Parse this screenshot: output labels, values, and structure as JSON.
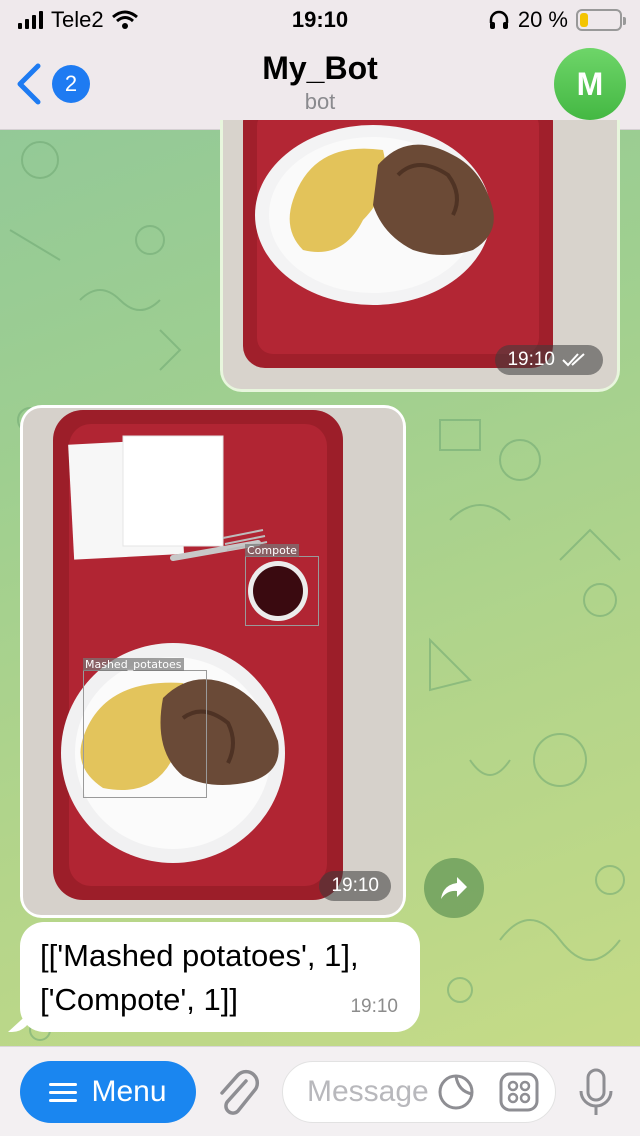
{
  "status_bar": {
    "carrier": "Tele2",
    "time": "19:10",
    "battery_percent": "20 %",
    "battery_level": 0.2
  },
  "header": {
    "back_badge": "2",
    "title": "My_Bot",
    "subtitle": "bot",
    "avatar_letter": "M"
  },
  "messages": {
    "outgoing_photo": {
      "time": "19:10"
    },
    "incoming_photo": {
      "time": "19:10",
      "detections": [
        {
          "label": "Compote"
        },
        {
          "label": "Mashed_potatoes"
        }
      ]
    },
    "incoming_text": {
      "text": "[['Mashed potatoes', 1],\n['Compote', 1]]",
      "time": "19:10"
    }
  },
  "input_bar": {
    "menu_label": "Menu",
    "message_placeholder": "Message"
  },
  "colors": {
    "accent": "#1a86f0",
    "avatar": "#44b843",
    "tray": "#9e1f2a"
  }
}
